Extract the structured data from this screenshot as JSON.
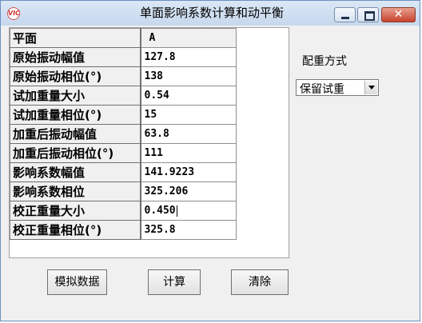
{
  "window": {
    "title": "单面影响系数计算和动平衡",
    "app_icon_text": "VIC",
    "close_glyph": "✕"
  },
  "grid": {
    "column_header": "A",
    "header_label": "平面",
    "rows": [
      {
        "label": "原始振动幅值",
        "value": "127.8"
      },
      {
        "label": "原始振动相位(°)",
        "value": "138"
      },
      {
        "label": "试加重量大小",
        "value": "0.54"
      },
      {
        "label": "试加重量相位(°)",
        "value": "15"
      },
      {
        "label": "加重后振动幅值",
        "value": "63.8"
      },
      {
        "label": "加重后振动相位(°)",
        "value": "111"
      },
      {
        "label": "影响系数幅值",
        "value": "141.9223"
      },
      {
        "label": "影响系数相位",
        "value": "325.206"
      },
      {
        "label": "校正重量大小",
        "value": "0.450"
      },
      {
        "label": "校正重量相位(°)",
        "value": "325.8"
      }
    ]
  },
  "counterweight": {
    "label": "配重方式",
    "selected": "保留试重"
  },
  "buttons": {
    "simulate": "模拟数据",
    "calculate": "计算",
    "clear": "清除"
  }
}
